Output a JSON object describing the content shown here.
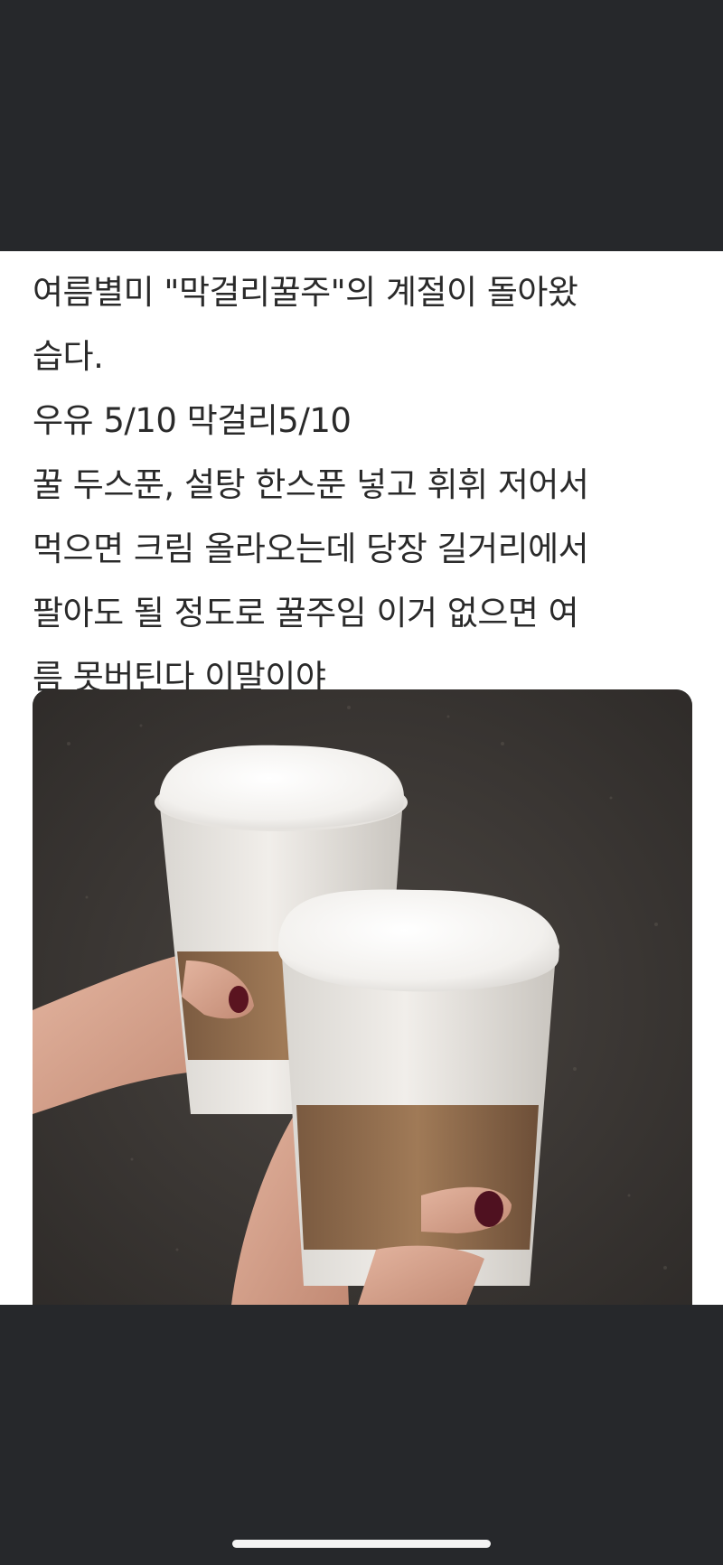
{
  "post": {
    "lines": [
      "여름별미 \"막걸리꿀주\"의 계절이 돌아왔",
      "습다.",
      "우유 5/10 막걸리5/10",
      "꿀 두스푼, 설탕 한스푼 넣고 휘휘 저어서",
      "먹으면 크림 올라오는데 당장 길거리에서",
      "팔아도 될 정도로 꿀주임 이거 없으면 여",
      "름 못버틴다 이말이야"
    ]
  },
  "colors": {
    "background": "#26282b",
    "card": "#ffffff",
    "text": "#2a2a2a",
    "home_indicator": "#f4f4f4"
  }
}
